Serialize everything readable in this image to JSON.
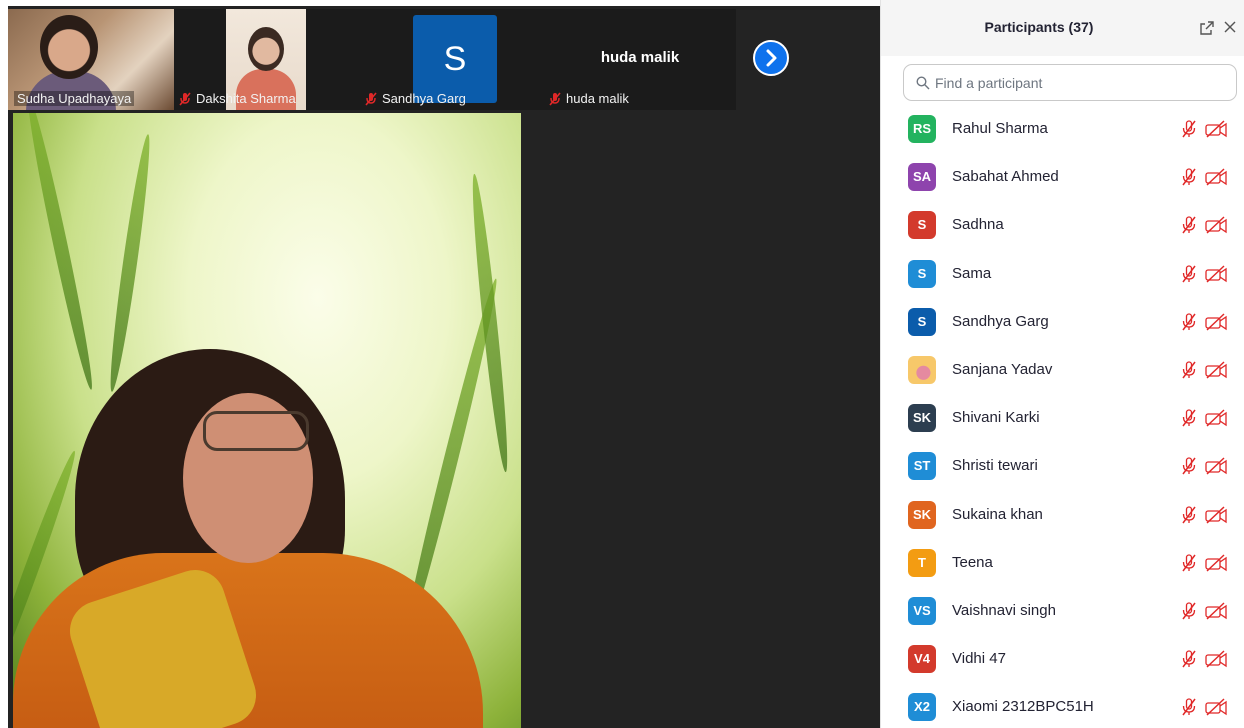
{
  "thumbnails": [
    {
      "name": "Sudha Upadhayaya",
      "muted": false
    },
    {
      "name": "Dakshita Sharma",
      "muted": true
    },
    {
      "name": "Sandhya Garg",
      "muted": true,
      "avatar_letter": "S",
      "avatar_color": "#0b5cab"
    },
    {
      "name": "huda malik",
      "muted": true,
      "display_name": "huda malik"
    }
  ],
  "next_page_icon": "chevron-right-icon",
  "panel": {
    "title": "Participants (37)",
    "popout_icon": "popout-icon",
    "close_icon": "close-icon",
    "search_placeholder": "Find a participant"
  },
  "participants": [
    {
      "initials": "RS",
      "name": "Rahul Sharma",
      "color": "#23b35f"
    },
    {
      "initials": "SA",
      "name": "Sabahat Ahmed",
      "color": "#8e44ad"
    },
    {
      "initials": "S",
      "name": "Sadhna",
      "color": "#d33a2c"
    },
    {
      "initials": "S",
      "name": "Sama",
      "color": "#1f8dd6"
    },
    {
      "initials": "S",
      "name": "Sandhya Garg",
      "color": "#0b5cab"
    },
    {
      "initials": "",
      "name": "Sanjana Yadav",
      "color": "#f1b24a",
      "photo": true
    },
    {
      "initials": "SK",
      "name": "Shivani Karki",
      "color": "#2c3e50"
    },
    {
      "initials": "ST",
      "name": "Shristi tewari",
      "color": "#1f8dd6"
    },
    {
      "initials": "SK",
      "name": "Sukaina khan",
      "color": "#e0651f"
    },
    {
      "initials": "T",
      "name": "Teena",
      "color": "#f39c12"
    },
    {
      "initials": "VS",
      "name": "Vaishnavi singh",
      "color": "#1f8dd6"
    },
    {
      "initials": "V4",
      "name": "Vidhi 47",
      "color": "#d33a2c"
    },
    {
      "initials": "X2",
      "name": "Xiaomi 2312BPC51H",
      "color": "#1f8dd6"
    }
  ],
  "status_colors": {
    "muted": "#e02828"
  }
}
